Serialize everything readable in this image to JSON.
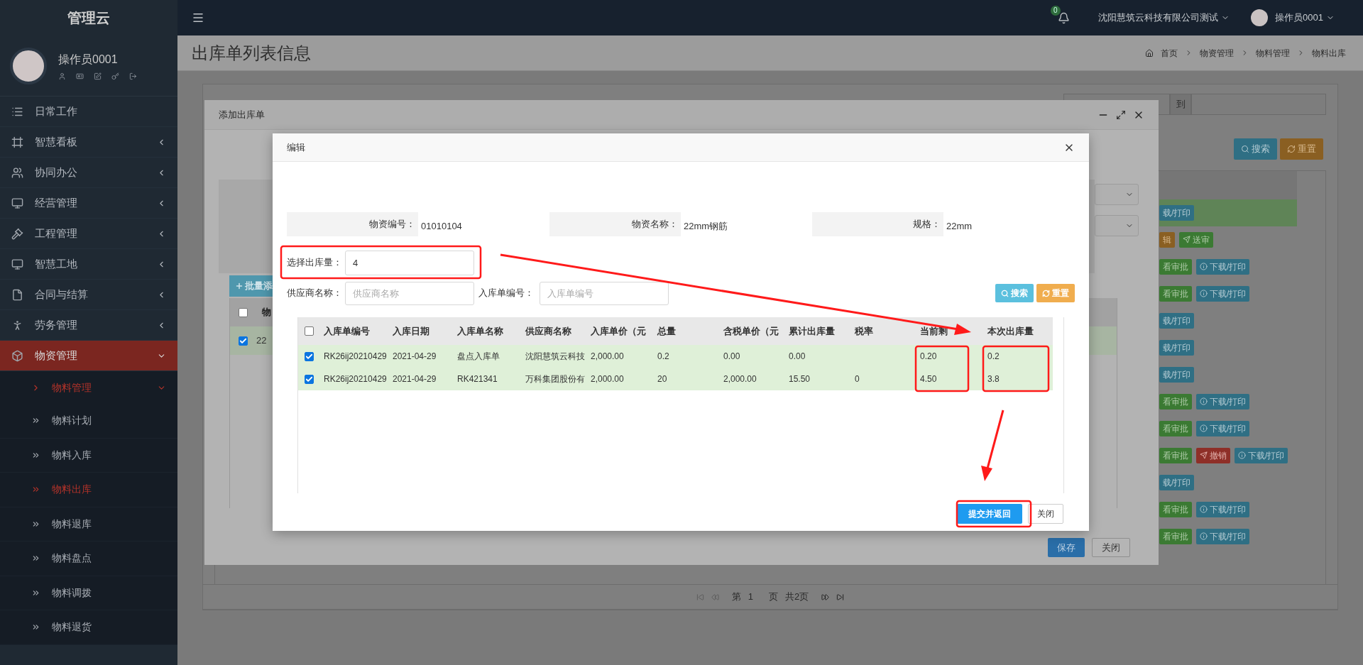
{
  "sidebar": {
    "brand": "管理云",
    "user": {
      "name": "操作员0001"
    },
    "items": [
      {
        "label": "日常工作",
        "selected": false
      },
      {
        "label": "智慧看板",
        "expanded": false,
        "selected": false
      },
      {
        "label": "协同办公",
        "expanded": false,
        "selected": false
      },
      {
        "label": "经营管理",
        "expanded": false,
        "selected": false
      },
      {
        "label": "工程管理",
        "expanded": false,
        "selected": false
      },
      {
        "label": "智慧工地",
        "expanded": false,
        "selected": false
      },
      {
        "label": "合同与结算",
        "expanded": false,
        "selected": false
      },
      {
        "label": "劳务管理",
        "expanded": false,
        "selected": false
      },
      {
        "label": "物资管理",
        "expanded": true,
        "selected": true,
        "children": [
          {
            "label": "物料管理",
            "expanded": true,
            "active": true,
            "children": [
              {
                "label": "物料计划",
                "selected": false
              },
              {
                "label": "物料入库",
                "selected": false
              },
              {
                "label": "物料出库",
                "selected": true
              },
              {
                "label": "物料退库",
                "selected": false
              },
              {
                "label": "物料盘点",
                "selected": false
              },
              {
                "label": "物料调拨",
                "selected": false
              },
              {
                "label": "物料退货",
                "selected": false
              }
            ]
          }
        ]
      }
    ]
  },
  "topbar": {
    "notification_count": "0",
    "company": "沈阳慧筑云科技有限公司测试",
    "user": "操作员0001"
  },
  "page": {
    "title": "出库单列表信息",
    "breadcrumb": [
      "首页",
      "物资管理",
      "物料管理",
      "物料出库"
    ],
    "filter_to_label": "到",
    "search_button": "搜索",
    "reset_button": "重置",
    "action_rows": [
      {
        "selected": true,
        "buttons": [
          {
            "kind": "printcut",
            "label": "载/打印"
          }
        ]
      },
      {
        "selected": false,
        "buttons": [
          {
            "kind": "edit",
            "label": "辑"
          },
          {
            "kind": "send",
            "label": "送审"
          }
        ]
      },
      {
        "selected": false,
        "buttons": [
          {
            "kind": "approve",
            "label": "看审批"
          },
          {
            "kind": "print",
            "label": "下载/打印"
          }
        ]
      },
      {
        "selected": false,
        "buttons": [
          {
            "kind": "approve",
            "label": "看审批"
          },
          {
            "kind": "print",
            "label": "下载/打印"
          }
        ]
      },
      {
        "selected": false,
        "buttons": [
          {
            "kind": "printcut",
            "label": "载/打印"
          }
        ]
      },
      {
        "selected": false,
        "buttons": [
          {
            "kind": "printcut",
            "label": "载/打印"
          }
        ]
      },
      {
        "selected": false,
        "buttons": [
          {
            "kind": "printcut",
            "label": "载/打印"
          }
        ]
      },
      {
        "selected": false,
        "buttons": [
          {
            "kind": "approve",
            "label": "看审批"
          },
          {
            "kind": "print",
            "label": "下载/打印"
          }
        ]
      },
      {
        "selected": false,
        "buttons": [
          {
            "kind": "approve",
            "label": "看审批"
          },
          {
            "kind": "print",
            "label": "下载/打印"
          }
        ]
      },
      {
        "selected": false,
        "buttons": [
          {
            "kind": "approve",
            "label": "看审批"
          },
          {
            "kind": "revoke",
            "label": "撤销"
          },
          {
            "kind": "print",
            "label": "下载/打印"
          }
        ]
      },
      {
        "selected": false,
        "buttons": [
          {
            "kind": "printcut",
            "label": "载/打印"
          }
        ]
      },
      {
        "selected": false,
        "buttons": [
          {
            "kind": "approve",
            "label": "看审批"
          },
          {
            "kind": "print",
            "label": "下载/打印"
          }
        ]
      },
      {
        "selected": false,
        "buttons": [
          {
            "kind": "approve",
            "label": "看审批"
          },
          {
            "kind": "print",
            "label": "下载/打印"
          }
        ]
      }
    ],
    "pagination": {
      "page_prefix": "第",
      "page": "1",
      "page_suffix": "页",
      "total": "共2页"
    }
  },
  "outer_dialog": {
    "title": "添加出库单",
    "batch_add_button": "批量添",
    "table": {
      "column_1": "物",
      "all_checked": false,
      "row_checked": true,
      "row_value": "22"
    },
    "save_button": "保存",
    "close_button": "关闭"
  },
  "dialog": {
    "title": "编辑",
    "info": [
      {
        "label": "物资编号：",
        "value": "01010104"
      },
      {
        "label": "物资名称：",
        "value": "22mm钢筋"
      },
      {
        "label": "规格：",
        "value": "22mm"
      }
    ],
    "quantity": {
      "label": "选择出库量：",
      "value": "4"
    },
    "filters": [
      {
        "label": "供应商名称：",
        "placeholder": "供应商名称"
      },
      {
        "label": "入库单编号：",
        "placeholder": "入库单编号"
      }
    ],
    "search_button": "搜索",
    "reset_button": "重置",
    "table": {
      "all_checked": false,
      "columns": [
        "入库单编号",
        "入库日期",
        "入库单名称",
        "供应商名称",
        "入库单价（元",
        "总量",
        "含税单价（元",
        "累计出库量",
        "税率",
        "当前剩",
        "本次出库量"
      ],
      "rows": [
        {
          "checked": true,
          "cells": [
            "RK26ij20210429",
            "2021-04-29",
            "盘点入库单",
            "沈阳慧筑云科技",
            "2,000.00",
            "0.2",
            "0.00",
            "0.00",
            null,
            "0.20",
            "0.2"
          ]
        },
        {
          "checked": true,
          "cells": [
            "RK26ij20210429",
            "2021-04-29",
            "RK421341",
            "万科集团股份有",
            "2,000.00",
            "20",
            "2,000.00",
            "15.50",
            "0",
            "4.50",
            "3.8"
          ]
        }
      ]
    },
    "submit_button": "提交并返回",
    "close_button": "关闭"
  }
}
